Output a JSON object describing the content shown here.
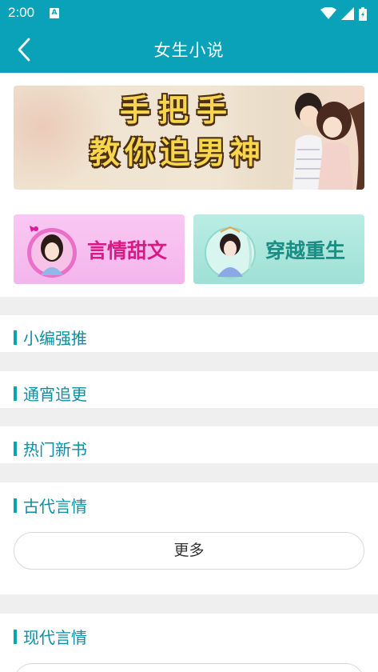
{
  "status_bar": {
    "time": "2:00",
    "notification_badge": "A"
  },
  "app_bar": {
    "title": "女生小说",
    "back_icon": "back-chevron-icon"
  },
  "banner": {
    "line1": "手把手",
    "line2": "教你追男神"
  },
  "categories": [
    {
      "label": "言情甜文"
    },
    {
      "label": "穿越重生"
    }
  ],
  "sections": [
    {
      "title": "小编强推"
    },
    {
      "title": "通宵追更"
    },
    {
      "title": "热门新书"
    },
    {
      "title": "古代言情",
      "more": "更多"
    },
    {
      "title": "现代言情"
    }
  ],
  "colors": {
    "primary": "#0aa2b8",
    "section_title": "#0a8fa3",
    "background": "#efefef"
  }
}
